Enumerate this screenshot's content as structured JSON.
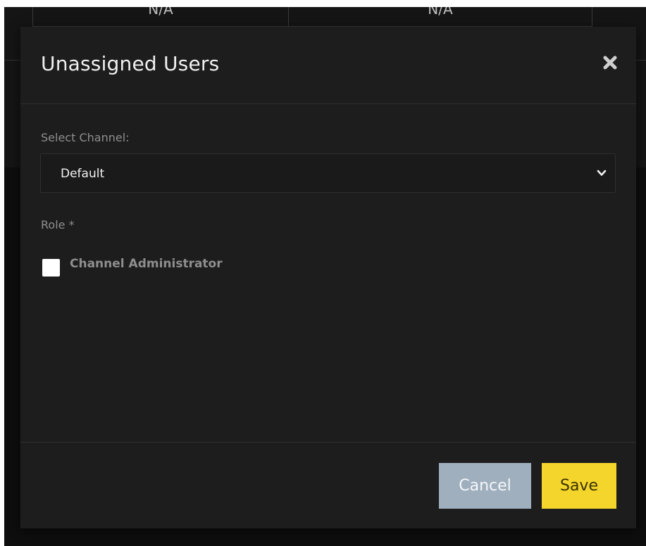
{
  "background": {
    "table_cells": [
      "N/A",
      "N/A"
    ]
  },
  "modal": {
    "title": "Unassigned Users",
    "close_icon": "close-icon",
    "channel_label": "Select Channel:",
    "channel_selected": "Default",
    "role_label": "Role *",
    "roles": [
      {
        "label": "Channel Administrator",
        "checked": false
      }
    ],
    "cancel_label": "Cancel",
    "save_label": "Save"
  },
  "colors": {
    "save_button": "#f3d52c",
    "cancel_button": "#9fafbd",
    "modal_background": "#1d1d1d"
  }
}
